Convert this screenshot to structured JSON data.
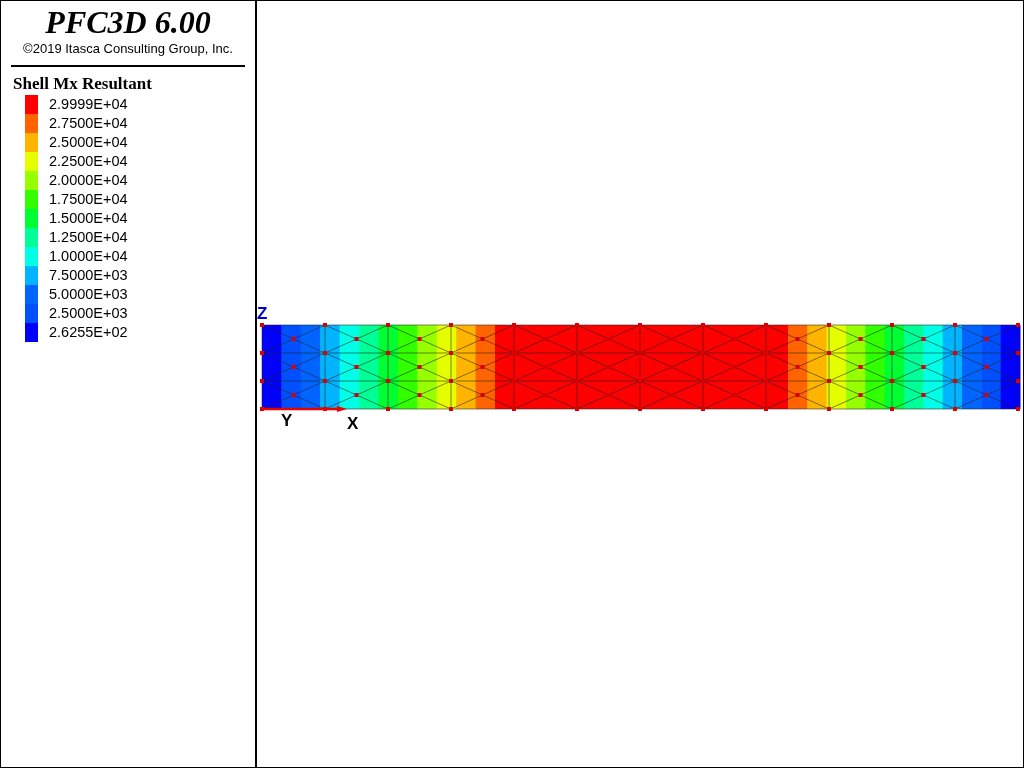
{
  "title": "PFC3D 6.00",
  "copyright": "©2019 Itasca Consulting Group, Inc.",
  "legend": {
    "title": "Shell Mx Resultant",
    "items": [
      {
        "label": "2.9999E+04",
        "color": "#ff0000"
      },
      {
        "label": "2.7500E+04",
        "color": "#ff6400"
      },
      {
        "label": "2.5000E+04",
        "color": "#ffb400"
      },
      {
        "label": "2.2500E+04",
        "color": "#e6ff00"
      },
      {
        "label": "2.0000E+04",
        "color": "#96ff00"
      },
      {
        "label": "1.7500E+04",
        "color": "#32ff00"
      },
      {
        "label": "1.5000E+04",
        "color": "#00ff32"
      },
      {
        "label": "1.2500E+04",
        "color": "#00ff96"
      },
      {
        "label": "1.0000E+04",
        "color": "#00ffe6"
      },
      {
        "label": "7.5000E+03",
        "color": "#00b4ff"
      },
      {
        "label": "5.0000E+03",
        "color": "#0064ff"
      },
      {
        "label": "2.5000E+03",
        "color": "#0050ff"
      },
      {
        "label": "2.6255E+02",
        "color": "#0000ff"
      }
    ]
  },
  "axes": {
    "z": "Z",
    "y": "Y",
    "x": "X"
  }
}
